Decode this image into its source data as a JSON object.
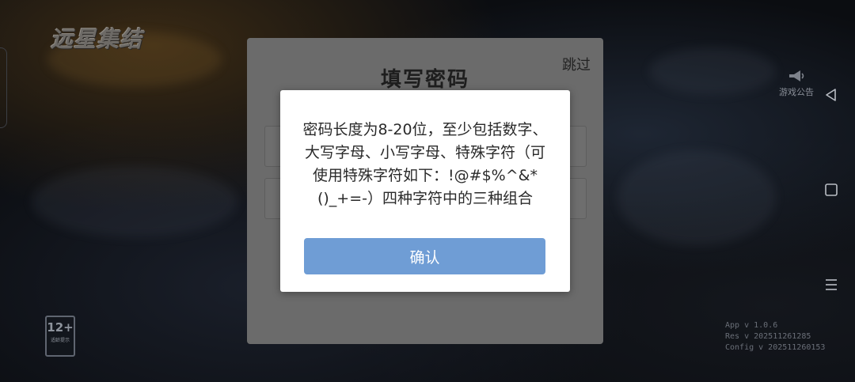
{
  "game": {
    "logo_text": "远星集结"
  },
  "side_controls": {
    "announcement_label": "游戏公告",
    "announcement_icon": "megaphone-icon",
    "back_icon": "triangle-back-icon",
    "home_icon": "square-home-icon",
    "menu_icon": "hamburger-menu-icon"
  },
  "age_rating": {
    "value": "12+",
    "subtext": "适龄提示"
  },
  "version": {
    "app": "App v  1.0.6",
    "res": "Res v  202511261285",
    "config": "Config v  202511260153"
  },
  "password_panel": {
    "title": "填写密码",
    "skip_label": "跳过"
  },
  "alert": {
    "message": "密码长度为8-20位，至少包括数字、大写字母、小写字母、特殊字符（可使用特殊字符如下：!@#$%^&*()_+=-）四种字符中的三种组合",
    "confirm_label": "确认",
    "confirm_color": "#6f9dd5"
  }
}
